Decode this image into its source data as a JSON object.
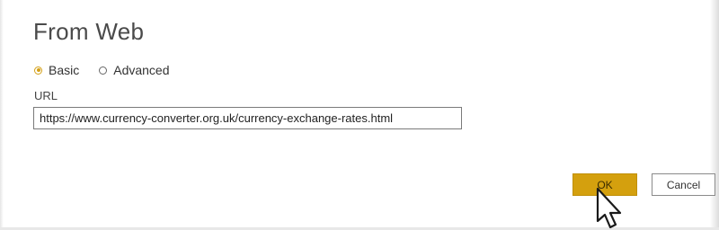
{
  "dialog": {
    "title": "From Web",
    "mode_options": [
      {
        "label": "Basic",
        "selected": true
      },
      {
        "label": "Advanced",
        "selected": false
      }
    ],
    "url_label": "URL",
    "url_value": "https://www.currency-converter.org.uk/currency-exchange-rates.html",
    "ok_label": "OK",
    "cancel_label": "Cancel"
  },
  "colors": {
    "accent": "#d4a00e",
    "text": "#4a4a4a"
  },
  "icons": {
    "cursor": "mouse-pointer-icon"
  }
}
